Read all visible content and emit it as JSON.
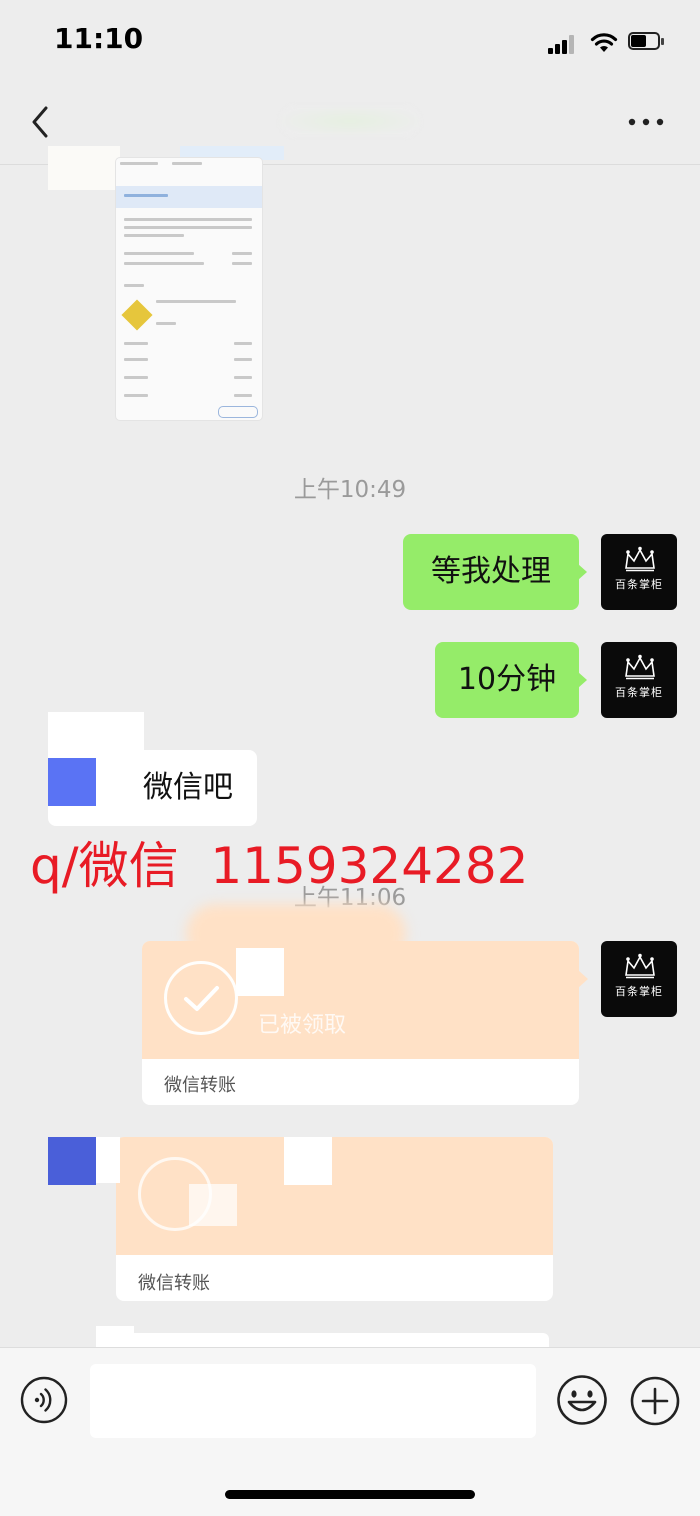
{
  "status_bar": {
    "time": "11:10"
  },
  "nav": {
    "title": ""
  },
  "chat": {
    "timestamp_1": "上午10:49",
    "timestamp_2": "上午11:06",
    "msg_wait": "等我处理",
    "msg_10min": "10分钟",
    "msg_wechat": "微信吧",
    "overlay_text": "q/微信  1159324282",
    "avatar_brand": "百条掌柜",
    "transfer_1": {
      "status": "已被领取",
      "footer": "微信转账"
    },
    "transfer_2": {
      "footer": "微信转账"
    }
  },
  "input_bar": {
    "placeholder": ""
  },
  "colors": {
    "sent_bubble": "#95ec69",
    "transfer_card": "#ffe1c6",
    "overlay_red": "#e81b25",
    "avatar_bg": "#0a0a0a",
    "placeholder_blue": "#5a73f4"
  }
}
